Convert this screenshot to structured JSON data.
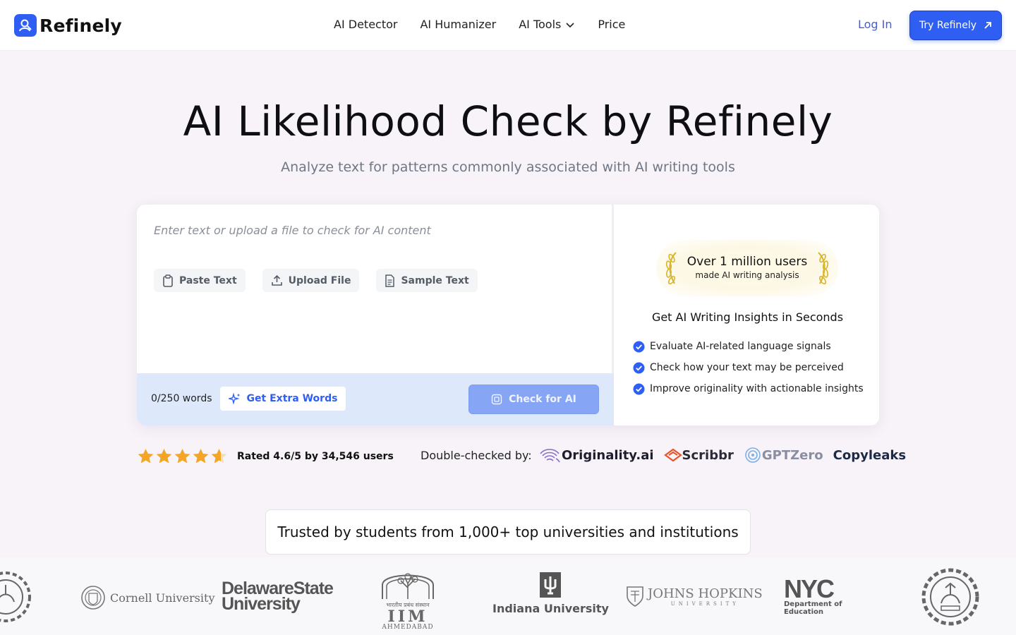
{
  "header": {
    "brand": "Refinely",
    "nav": [
      {
        "label": "AI Detector"
      },
      {
        "label": "AI Humanizer"
      },
      {
        "label": "AI Tools"
      },
      {
        "label": "Price"
      }
    ],
    "login_label": "Log In",
    "try_label": "Try Refinely"
  },
  "hero": {
    "title": "AI Likelihood Check by Refinely",
    "subtitle": "Analyze text for patterns commonly associated with AI writing tools"
  },
  "editor": {
    "placeholder": "Enter text or upload a file to check for AI content",
    "tools": [
      {
        "label": "Paste Text",
        "icon": "clipboard-icon"
      },
      {
        "label": "Upload File",
        "icon": "upload-icon"
      },
      {
        "label": "Sample Text",
        "icon": "document-icon"
      }
    ],
    "word_count": "0/250 words",
    "extra_words_label": "Get Extra Words",
    "check_label": "Check for AI"
  },
  "side_panel": {
    "award_line1": "Over 1 million users",
    "award_line2": "made AI writing analysis",
    "title": "Get AI Writing Insights in Seconds",
    "benefits": [
      "Evaluate AI-related language signals",
      "Check how your text may be perceived",
      "Improve originality with actionable insights"
    ]
  },
  "rating": {
    "stars": 4.6,
    "text": "Rated 4.6/5 by 34,546 users"
  },
  "double_checked": {
    "label": "Double-checked by:",
    "partners": [
      "Originality.ai",
      "Scribbr",
      "GPTZero",
      "Copyleaks"
    ]
  },
  "trusted": {
    "text": "Trusted by students from 1,000+ top universities and institutions"
  },
  "universities": {
    "cornell": "Cornell University",
    "delaware_line1": "DelawareState",
    "delaware_line2": "University",
    "iim_devanagari": "भारतीय प्रबंध संस्थान",
    "iim": "IIM",
    "iim_city": "AHMEDABAD",
    "indiana": "Indiana University",
    "jhu": "JOHNS HOPKINS",
    "jhu_sub": "UNIVERSITY",
    "nyc": "NYC",
    "nyc_line1": "Department of",
    "nyc_line2": "Education"
  },
  "colors": {
    "brand_blue": "#2f5ef2",
    "check_disabled": "#86a5f4",
    "footer_bg": "#dde9fb",
    "star": "#f5a524"
  }
}
